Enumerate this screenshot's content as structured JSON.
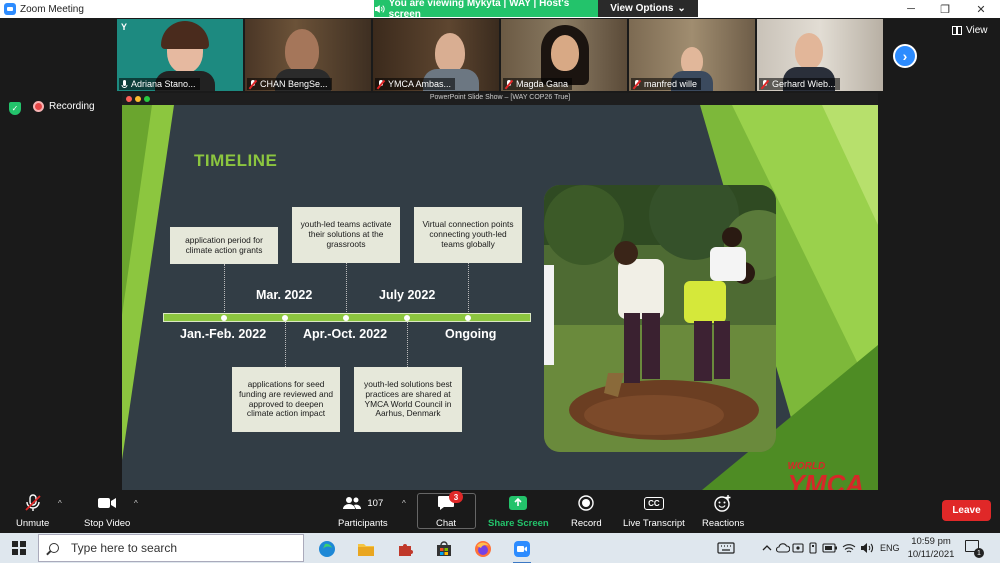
{
  "window": {
    "title": "Zoom Meeting",
    "minimize": "─",
    "maximize": "❐",
    "close": "✕"
  },
  "banner": {
    "viewing_text": "You are viewing Mykyta | WAY | Host's screen",
    "view_options": "View Options",
    "view_options_caret": "⌄"
  },
  "gallery": {
    "participants": [
      {
        "name": "Adriana Stano...",
        "muted": false
      },
      {
        "name": "CHAN BengSe...",
        "muted": true
      },
      {
        "name": "YMCA Ambas...",
        "muted": true
      },
      {
        "name": "Magda Gana",
        "muted": true
      },
      {
        "name": "manfred wille",
        "muted": true
      },
      {
        "name": "Gerhard Wieb...",
        "muted": true
      }
    ],
    "next_arrow": "›",
    "view_label": "View"
  },
  "status": {
    "recording_label": "Recording",
    "shield_mark": "✓"
  },
  "slide": {
    "window_title": "PowerPoint Slide Show – [WAY COP26 True]",
    "heading": "TIMELINE",
    "top_boxes": [
      "application period for climate action grants",
      "youth-led teams activate their solutions at the grassroots",
      "Virtual connection points connecting youth-led teams globally"
    ],
    "bottom_boxes": [
      "applications for seed funding are reviewed and approved to deepen climate action impact",
      "youth-led solutions best practices are shared at YMCA World Council in Aarhus, Denmark"
    ],
    "dates_top": [
      "Mar. 2022",
      "July 2022"
    ],
    "dates_bottom": [
      "Jan.-Feb. 2022",
      "Apr.-Oct. 2022",
      "Ongoing"
    ],
    "brand_small": "WORLD",
    "brand_large": "YMCA",
    "accent_color": "#8cc63f"
  },
  "controls": {
    "unmute": "Unmute",
    "stop_video": "Stop Video",
    "participants": "Participants",
    "participants_count": "107",
    "chat": "Chat",
    "chat_badge": "3",
    "share_screen": "Share Screen",
    "record": "Record",
    "live_transcript": "Live Transcript",
    "cc_glyph": "CC",
    "reactions": "Reactions",
    "leave": "Leave",
    "caret": "^"
  },
  "taskbar": {
    "search_placeholder": "Type here to search",
    "language": "ENG",
    "time": "10:59 pm",
    "date": "10/11/2021",
    "notification_count": "1"
  }
}
